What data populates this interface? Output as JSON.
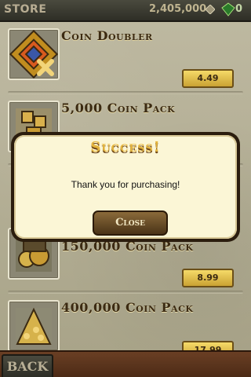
{
  "header": {
    "title": "STORE",
    "coins": "2,405,000",
    "gems": "0"
  },
  "products": [
    {
      "name": "Coin Doubler",
      "price": "4.49"
    },
    {
      "name": "5,000 Coin Pack",
      "price": ""
    },
    {
      "name": "150,000 Coin Pack",
      "price": "8.99"
    },
    {
      "name": "400,000 Coin Pack",
      "price": "17.99"
    }
  ],
  "footer": {
    "back_label": "BACK"
  },
  "dialog": {
    "title": "Success!",
    "message": "Thank you for purchasing!",
    "close_label": "Close"
  },
  "colors": {
    "accent_gold": "#e2b33d",
    "stone": "#bdb8a0",
    "header": "#2e2e26"
  }
}
